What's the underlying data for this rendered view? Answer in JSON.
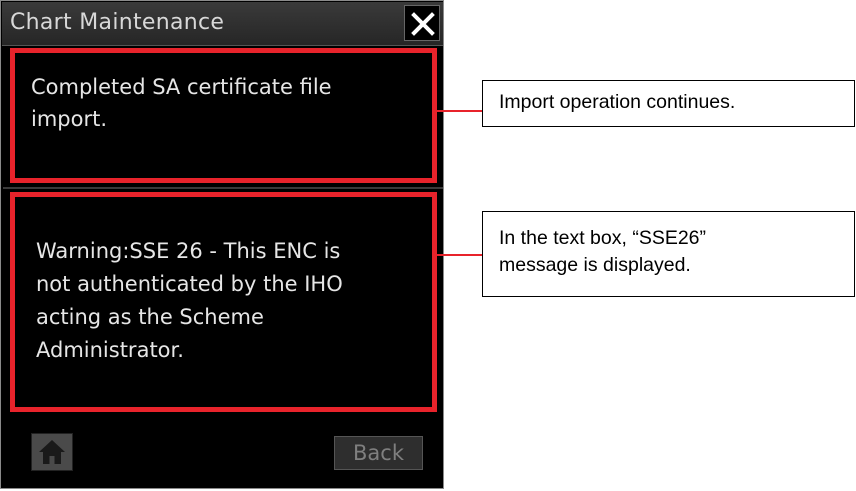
{
  "window": {
    "title": "Chart Maintenance",
    "close_icon": "close-icon"
  },
  "messages": [
    {
      "text": "Completed SA certificate file\nimport."
    },
    {
      "text": "Warning:SSE 26 - This ENC is\nnot authenticated by the IHO\nacting as the Scheme\nAdministrator."
    }
  ],
  "footer": {
    "home_icon": "home-icon",
    "back_label": "Back"
  },
  "callouts": [
    {
      "text": "Import operation continues."
    },
    {
      "text": "In the text box, “SSE26”\nmessage is displayed."
    }
  ],
  "colors": {
    "highlight": "#e8232b",
    "panel_bg": "#000000",
    "text": "#e6e6e6"
  }
}
